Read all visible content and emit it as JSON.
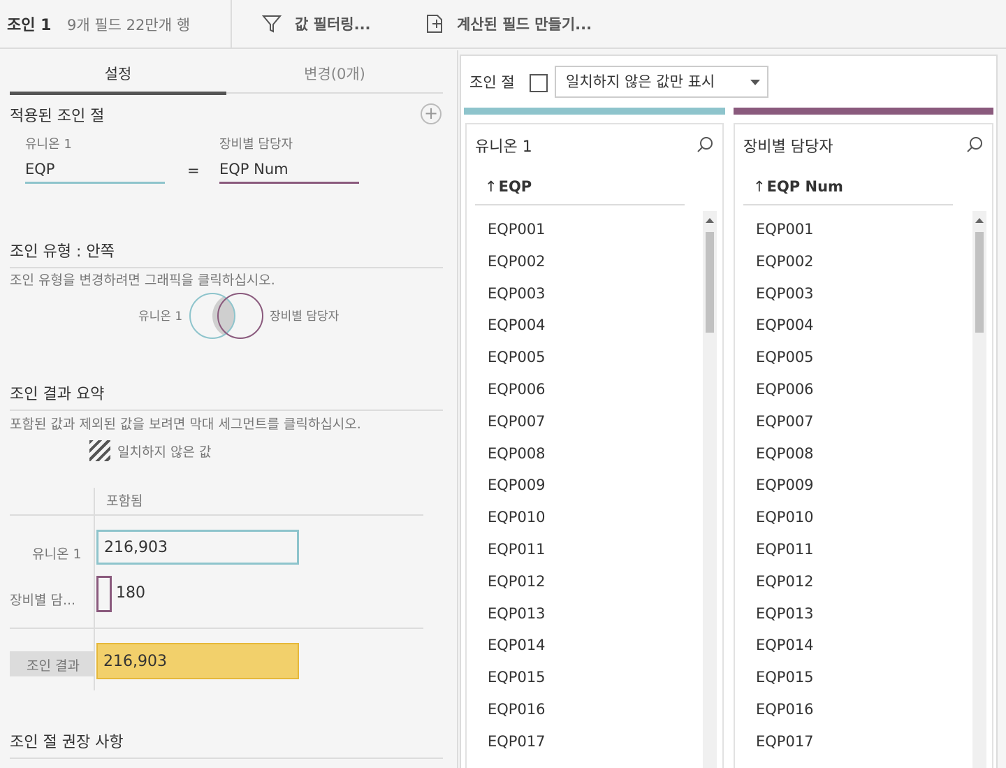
{
  "toolbar": {
    "title": "조인 1",
    "meta": "9개 필드  22만개 행",
    "filter_label": "값 필터링...",
    "calc_label": "계산된 필드 만들기..."
  },
  "tabs": [
    {
      "label": "설정",
      "active": true
    },
    {
      "label": "변경(0개)",
      "active": false
    }
  ],
  "join_clause": {
    "heading": "적용된 조인 절",
    "left_source": "유니온 1",
    "right_source": "장비별 담당자",
    "left_field": "EQP",
    "operator": "=",
    "right_field": "EQP Num"
  },
  "join_type": {
    "heading": "조인 유형 : 안쪽",
    "hint": "조인 유형을 변경하려면 그래픽을 클릭하십시오.",
    "venn_left": "유니온 1",
    "venn_right": "장비별 담당자"
  },
  "summary": {
    "heading": "조인 결과 요약",
    "hint": "포함된 값과 제외된 값을 보려면 막대 세그먼트를 클릭하십시오.",
    "legend": "일치하지 않은 값",
    "col_header": "포함됨",
    "rows": [
      {
        "label": "유니온 1",
        "value": "216,903"
      },
      {
        "label": "장비별 담...",
        "value": "180"
      }
    ],
    "result_label": "조인 결과",
    "result_value": "216,903"
  },
  "recommend": {
    "heading": "조인 절 권장 사항"
  },
  "right_panel": {
    "clause_label": "조인 절",
    "filter_option": "일치하지 않은 값만 표시",
    "filter_checked": false,
    "left_color": "#8ec4cc",
    "right_color": "#8a5a7d",
    "left_col": {
      "title": "유니온 1",
      "field": "EQP",
      "values": [
        "EQP001",
        "EQP002",
        "EQP003",
        "EQP004",
        "EQP005",
        "EQP006",
        "EQP007",
        "EQP008",
        "EQP009",
        "EQP010",
        "EQP011",
        "EQP012",
        "EQP013",
        "EQP014",
        "EQP015",
        "EQP016",
        "EQP017"
      ]
    },
    "right_col": {
      "title": "장비별 담당자",
      "field": "EQP Num",
      "values": [
        "EQP001",
        "EQP002",
        "EQP003",
        "EQP004",
        "EQP005",
        "EQP006",
        "EQP007",
        "EQP008",
        "EQP009",
        "EQP010",
        "EQP011",
        "EQP012",
        "EQP013",
        "EQP014",
        "EQP015",
        "EQP016",
        "EQP017"
      ]
    }
  }
}
